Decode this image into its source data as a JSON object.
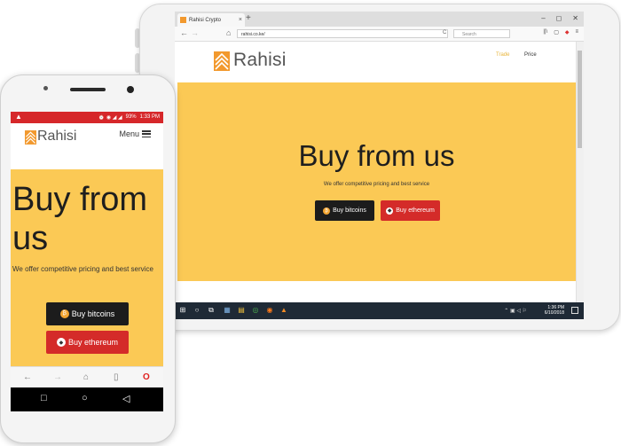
{
  "tablet": {
    "tab_title": "Rahisi Crypto",
    "tab_close": "×",
    "new_tab": "+",
    "win_controls": {
      "minimize": "–",
      "maximize": "◻",
      "close": "✕"
    },
    "nav": {
      "back": "←",
      "forward": "→",
      "home": "⌂",
      "url": "rahisi.co.ke/",
      "reload": "C",
      "search_placeholder": "Search"
    },
    "toolbar_icons": {
      "library": "||\\",
      "reader": "▢",
      "shield": "◆",
      "menu": "≡"
    },
    "brand": "Rahisi",
    "nav_links": [
      "Trade",
      "Price"
    ],
    "hero": {
      "title": "Buy from us",
      "subtitle": "We offer competitive pricing and best service",
      "buy_bitcoins": "Buy bitcoins",
      "buy_ethereum": "Buy ethereum",
      "coin_icon": "₿",
      "eth_icon": "◆"
    },
    "taskbar": {
      "start": "⊞",
      "cortana": "○",
      "task_view": "⧉",
      "apps": [
        "▦",
        "▤",
        "◎",
        "◉",
        "▲"
      ],
      "tray": "⌃ ▣ ◁ ⚐",
      "time": "1:36 PM",
      "date": "6/10/2018"
    },
    "colors": {
      "hero": "#fbc955",
      "button_dark": "#1c1c1c",
      "button_red": "#d42b29",
      "active_link": "#e8b43a"
    }
  },
  "phone": {
    "status_warning": "▲",
    "status_icons": "⏰ ◉ ◢ ◢",
    "battery": "93%",
    "time": "1:33 PM",
    "brand": "Rahisi",
    "menu_label": "Menu",
    "hero": {
      "title": "Buy from us",
      "subtitle": "We offer competitive pricing and best service",
      "buy_bitcoins": "Buy bitcoins",
      "buy_ethereum": "Buy ethereum",
      "coin_icon": "₿",
      "eth_icon": "◆"
    },
    "browser_bar": {
      "back": "←",
      "forward": "→",
      "home": "⌂",
      "tabs": "▯",
      "opera": "O"
    },
    "system_nav": {
      "recents": "□",
      "home": "○",
      "back": "◁"
    }
  }
}
